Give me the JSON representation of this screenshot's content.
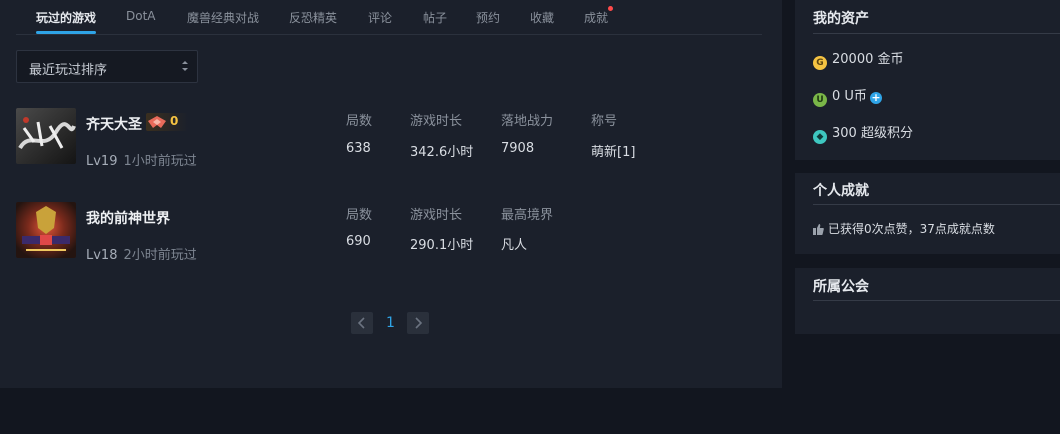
{
  "tabs": [
    {
      "label": "玩过的游戏"
    },
    {
      "label": "DotA"
    },
    {
      "label": "魔兽经典对战"
    },
    {
      "label": "反恐精英"
    },
    {
      "label": "评论"
    },
    {
      "label": "帖子"
    },
    {
      "label": "预约"
    },
    {
      "label": "收藏"
    },
    {
      "label": "成就"
    }
  ],
  "sort": {
    "label": "最近玩过排序"
  },
  "games": [
    {
      "name": "齐天大圣",
      "badge_count": "0",
      "level": "Lv19",
      "last_played": "1小时前玩过",
      "stats": [
        {
          "head": "局数",
          "value": "638"
        },
        {
          "head": "游戏时长",
          "value": "342.6小时"
        },
        {
          "head": "落地战力",
          "value": "7908"
        },
        {
          "head": "称号",
          "value": "萌新[1]"
        }
      ]
    },
    {
      "name": "我的前神世界",
      "level": "Lv18",
      "last_played": "2小时前玩过",
      "stats": [
        {
          "head": "局数",
          "value": "690"
        },
        {
          "head": "游戏时长",
          "value": "290.1小时"
        },
        {
          "head": "最高境界",
          "value": "凡人"
        }
      ]
    }
  ],
  "pagination": {
    "current": "1"
  },
  "assets": {
    "title": "我的资产",
    "gold": {
      "icon": "G",
      "text": "20000 金币"
    },
    "ucoin": {
      "icon": "U",
      "text": "0 U币"
    },
    "points": {
      "text": "300 超级积分"
    }
  },
  "achievement": {
    "title": "个人成就",
    "text": "已获得0次点赞，37点成就点数"
  },
  "guild": {
    "title": "所属公会"
  },
  "colors": {
    "accent": "#2fa4e7",
    "gold": "#f5c342",
    "ucoin": "#7ab648",
    "points": "#3ec7c0"
  }
}
